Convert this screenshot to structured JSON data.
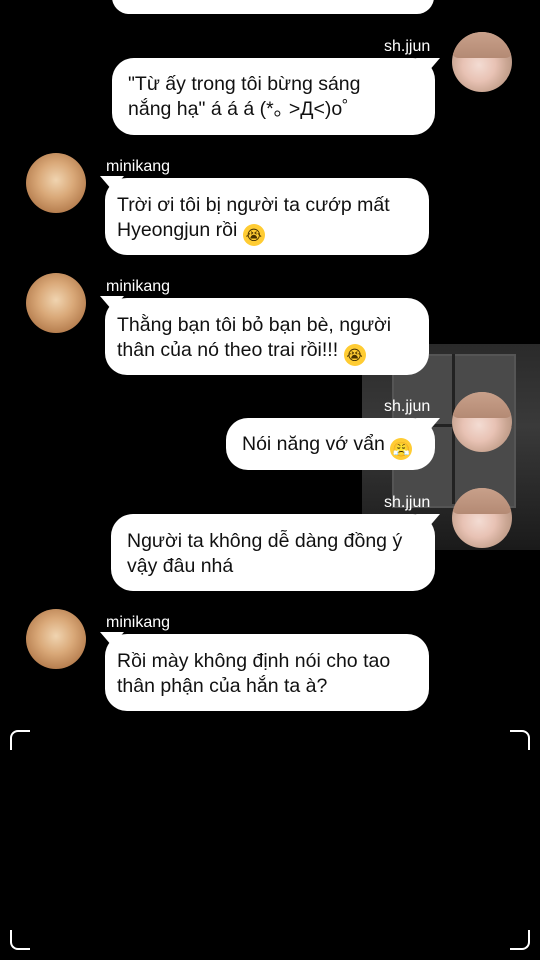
{
  "messages": [
    {
      "sender": "sh.jjun",
      "text": "\"Từ ấy trong tôi bừng sáng\nnắng hạ\" á á á (*｡ >Д<)o゜",
      "emoji": ""
    },
    {
      "sender": "minikang",
      "text": "Trời ơi tôi bị người ta cướp mất\nHyeongjun rồi ",
      "emoji": "😭"
    },
    {
      "sender": "minikang",
      "text": "Thằng bạn tôi bỏ bạn bè, người\nthân của nó theo trai rồi!!! ",
      "emoji": "😭"
    },
    {
      "sender": "sh.jjun",
      "text": "Nói năng vớ vẩn ",
      "emoji": "😤"
    },
    {
      "sender": "sh.jjun",
      "text": "Người ta không dễ dàng đồng ý\nvậy đâu nhá",
      "emoji": ""
    },
    {
      "sender": "minikang",
      "text": "Rồi mày không định nói cho tao\nthân phận của hắn ta à?",
      "emoji": ""
    }
  ],
  "colors": {
    "background": "#000000",
    "bubble": "#ffffff",
    "text": "#111111",
    "emoji": "#ffcc33"
  },
  "icons": {
    "crying": "loudly-crying-face-icon",
    "angry": "face-with-steam-icon"
  }
}
